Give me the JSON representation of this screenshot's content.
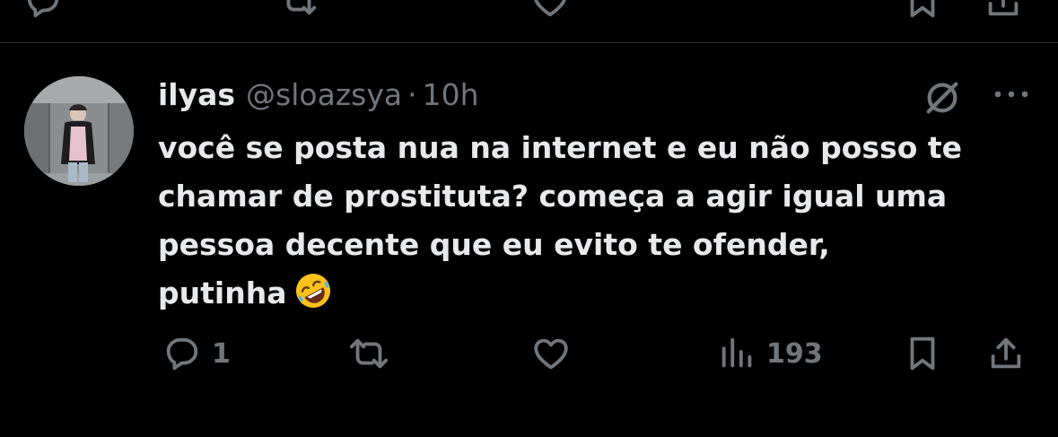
{
  "tweet": {
    "display_name": "ilyas",
    "handle": "@sloazsya",
    "separator": "·",
    "time": "10h",
    "text_lines": [
      "você se posta nua na internet e eu não posso te",
      "chamar de prostituta? começa a agir igual uma",
      "pessoa decente que eu evito te ofender,",
      "putinha"
    ],
    "emoji": "rolling-on-the-floor-laughing"
  },
  "actions": {
    "reply_count": "1",
    "views_count": "193"
  },
  "icons": {
    "reply": "reply-icon",
    "retweet": "retweet-icon",
    "like": "like-icon",
    "views": "views-icon",
    "bookmark": "bookmark-icon",
    "share": "share-icon",
    "grok": "grok-icon",
    "more": "more-icon"
  },
  "colors": {
    "background": "#000000",
    "text": "#e7e9ea",
    "secondary": "#71767b",
    "divider": "#2f3336"
  }
}
